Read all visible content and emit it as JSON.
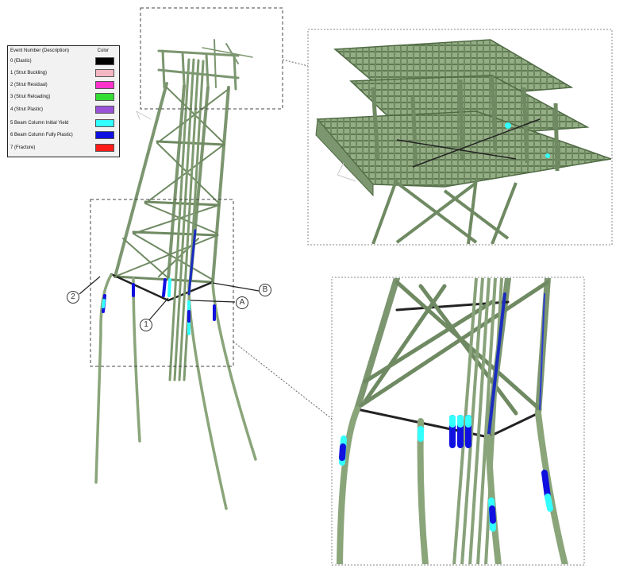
{
  "legend": {
    "header_event": "Event Number (Description)",
    "header_color": "Color",
    "rows": [
      {
        "label": "0 (Elastic)",
        "color": "#000000"
      },
      {
        "label": "1 (Strut Buckling)",
        "color": "#f4b6c2"
      },
      {
        "label": "2 (Strut Residual)",
        "color": "#ff33cc"
      },
      {
        "label": "3 (Strut Reloading)",
        "color": "#33dd33"
      },
      {
        "label": "4 (Strut Plastic)",
        "color": "#9a52d9"
      },
      {
        "label": "5 Beam Column Initial Yield",
        "color": "#33ffff"
      },
      {
        "label": "6 Beam Column Fully Plastic)",
        "color": "#1010e0"
      },
      {
        "label": "7 (Fracture)",
        "color": "#ff1a1a"
      }
    ]
  },
  "callouts": {
    "c1": "1",
    "c2": "2",
    "cA": "A",
    "cB": "B"
  },
  "colors": {
    "member": "#8aa57a",
    "member_dark": "#5f7a52",
    "yield_cyan": "#33ffff",
    "plastic_blue": "#1010e0"
  }
}
